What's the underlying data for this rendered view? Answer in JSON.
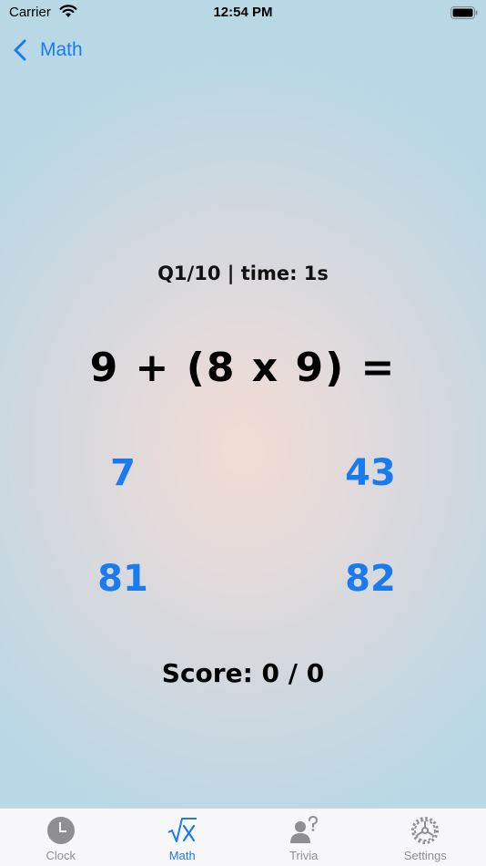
{
  "status_bar": {
    "carrier": "Carrier",
    "time": "12:54 PM"
  },
  "nav": {
    "back_label": "Math"
  },
  "quiz": {
    "status": "Q1/10 | time: 1s",
    "equation": "9 + (8 x 9) =",
    "answers": [
      "7",
      "43",
      "81",
      "82"
    ],
    "score": "Score: 0 / 0"
  },
  "tabs": [
    {
      "label": "Clock",
      "icon": "clock-icon",
      "active": false
    },
    {
      "label": "Math",
      "icon": "square-root-icon",
      "active": true
    },
    {
      "label": "Trivia",
      "icon": "person-question-icon",
      "active": false
    },
    {
      "label": "Settings",
      "icon": "gear-icon",
      "active": false
    }
  ],
  "colors": {
    "accent": "#1a7bf0",
    "inactive": "#8e8e93"
  }
}
